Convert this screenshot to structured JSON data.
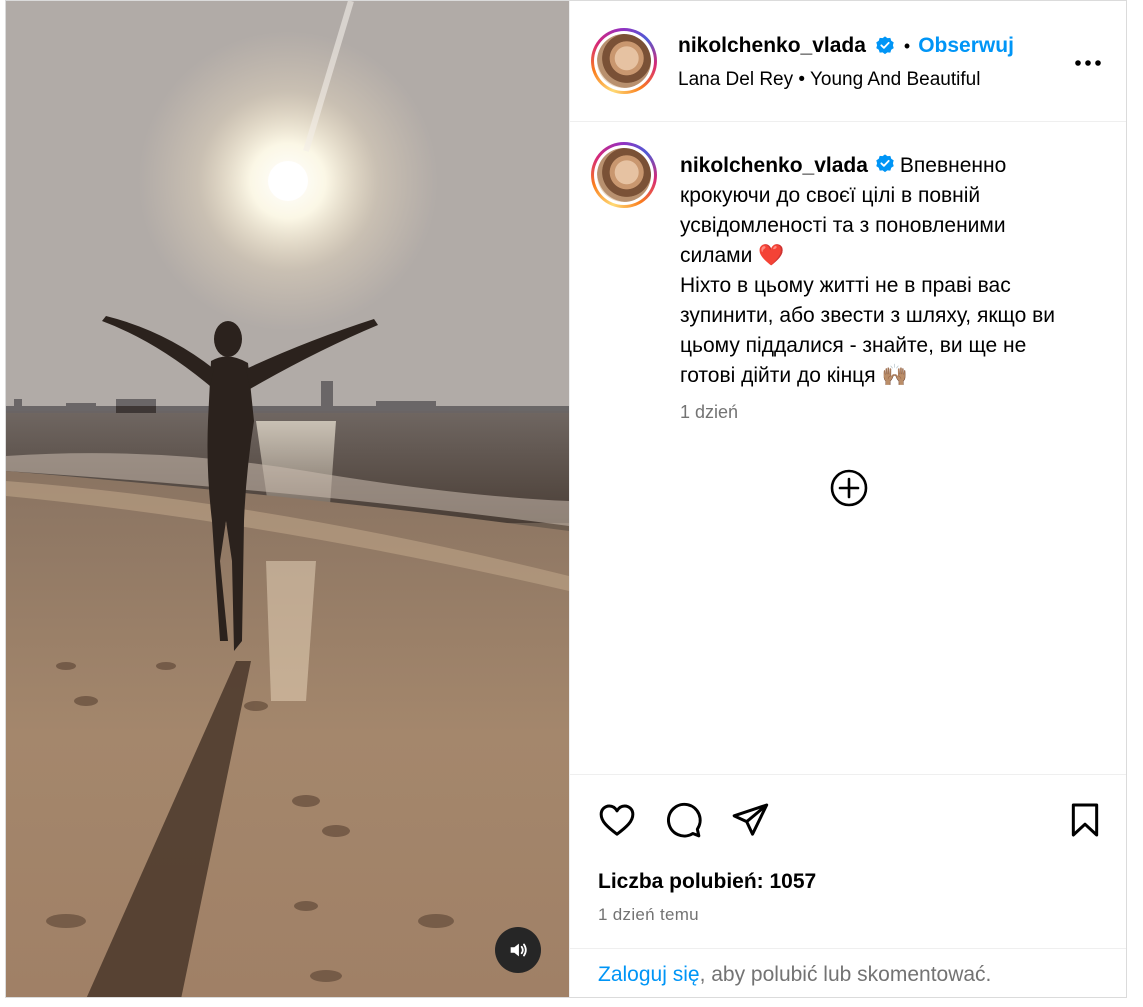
{
  "post": {
    "username": "nikolchenko_vlada",
    "verified_icon": "verified-badge-icon",
    "follow_label": "Obserwuj",
    "separator": "•",
    "song": "Lana Del Rey • Young And Beautiful"
  },
  "caption": {
    "username": "nikolchenko_vlada",
    "line1": "Впевненно крокуючи до своєї цілі в повній усвідомленості та з поновленими силами",
    "heart_emoji": "❤️",
    "line2": "Ніхто в цьому житті не в праві вас зупинити, або звести з шляху, якщо ви цьому піддалися - знайте, ви ще не готові дійти до кінця",
    "hands_emoji": "🙌🏽",
    "time": "1 dzień"
  },
  "actions": {
    "like_icon": "heart-outline-icon",
    "comment_icon": "comment-bubble-icon",
    "share_icon": "paper-plane-icon",
    "save_icon": "bookmark-icon",
    "more_icon": "ellipsis-icon",
    "load_more_icon": "plus-circle-icon",
    "sound_icon": "speaker-icon"
  },
  "stats": {
    "likes": "Liczba polubień: 1057",
    "time": "1 dzień temu"
  },
  "footer": {
    "login_link": "Zaloguj się",
    "login_rest": ", aby polubić lub skomentować."
  },
  "colors": {
    "accent": "#0095f6",
    "muted": "#737373",
    "border": "#efefef"
  }
}
